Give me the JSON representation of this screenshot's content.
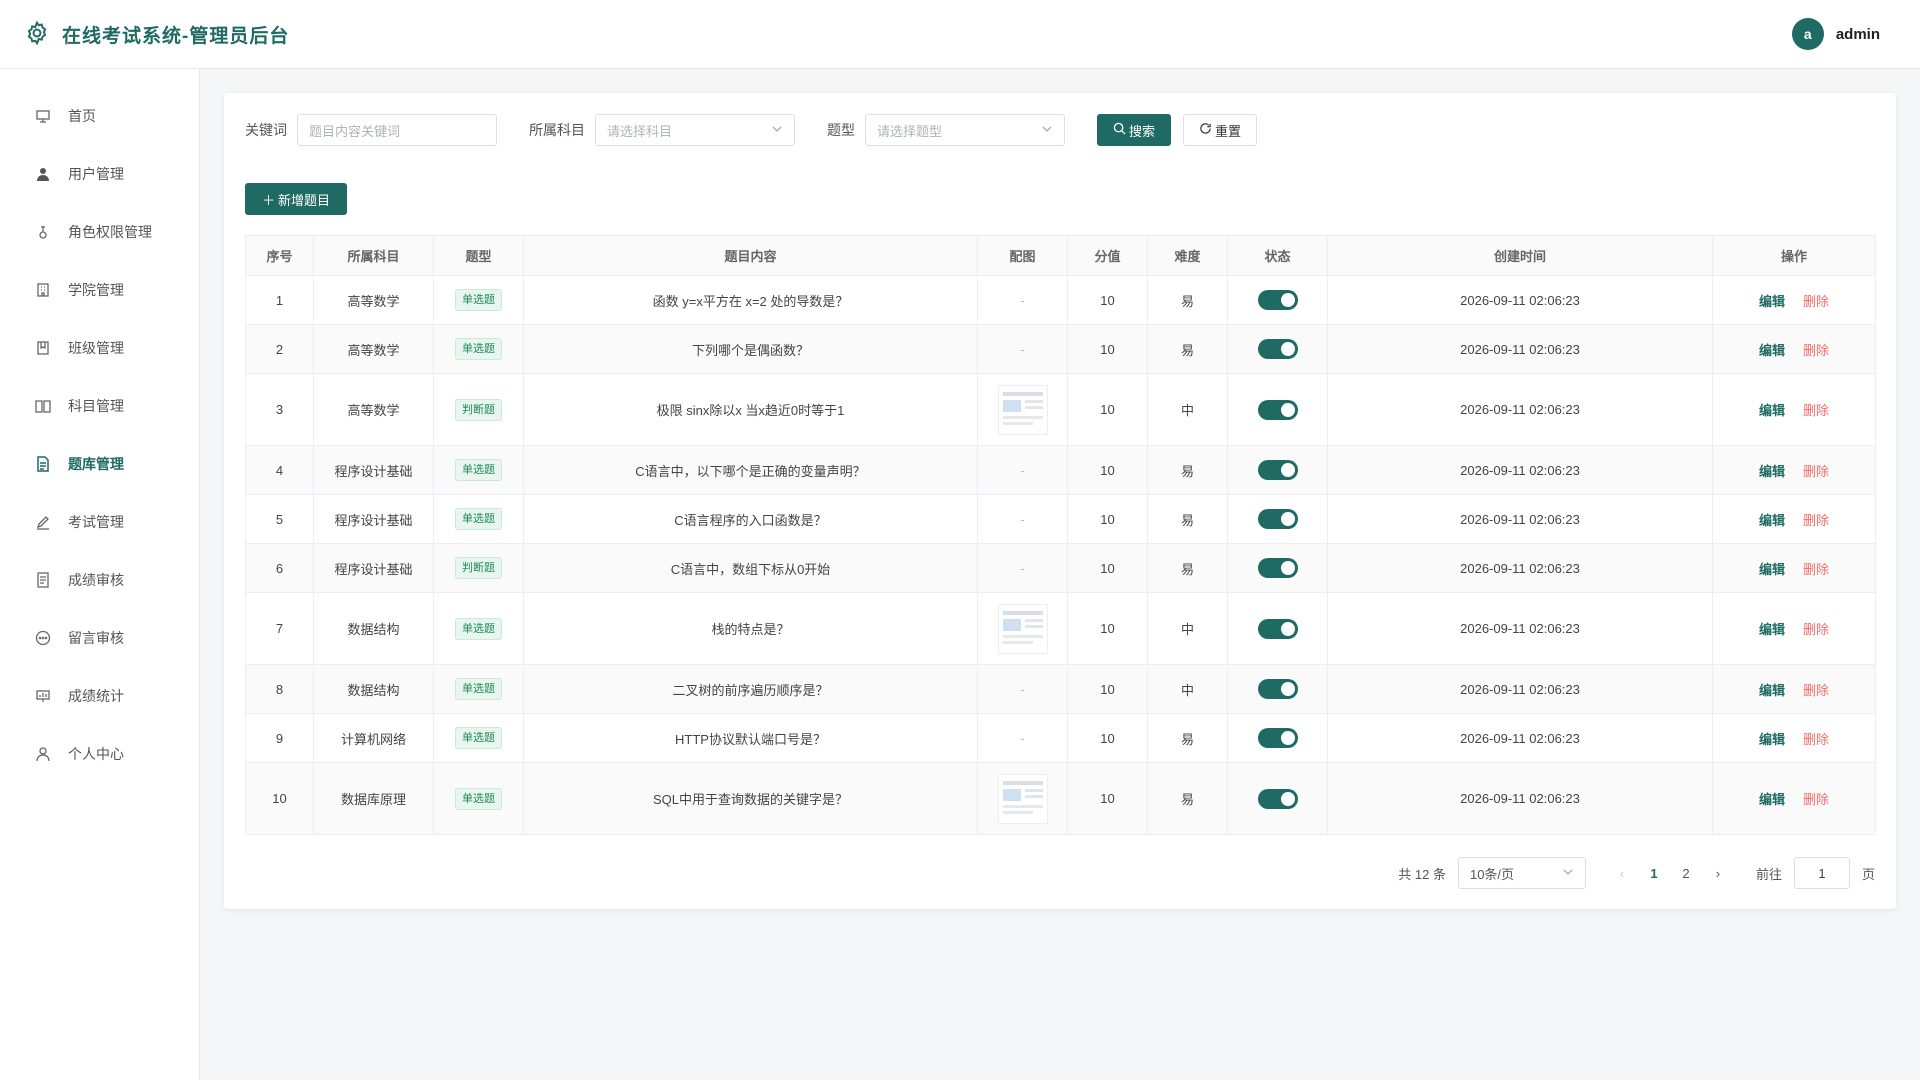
{
  "header": {
    "title": "在线考试系统-管理员后台",
    "avatar_letter": "a",
    "username": "admin"
  },
  "sidebar": {
    "items": [
      {
        "label": "首页",
        "icon": "home-icon"
      },
      {
        "label": "用户管理",
        "icon": "user-icon"
      },
      {
        "label": "角色权限管理",
        "icon": "role-icon"
      },
      {
        "label": "学院管理",
        "icon": "building-icon"
      },
      {
        "label": "班级管理",
        "icon": "class-icon"
      },
      {
        "label": "科目管理",
        "icon": "book-icon"
      },
      {
        "label": "题库管理",
        "icon": "question-bank-icon",
        "active": true
      },
      {
        "label": "考试管理",
        "icon": "exam-icon"
      },
      {
        "label": "成绩审核",
        "icon": "score-review-icon"
      },
      {
        "label": "留言审核",
        "icon": "message-icon"
      },
      {
        "label": "成绩统计",
        "icon": "stats-icon"
      },
      {
        "label": "个人中心",
        "icon": "profile-icon"
      }
    ]
  },
  "filters": {
    "keyword_label": "关键词",
    "keyword_placeholder": "题目内容关键词",
    "subject_label": "所属科目",
    "subject_placeholder": "请选择科目",
    "type_label": "题型",
    "type_placeholder": "请选择题型",
    "search_label": "搜索",
    "reset_label": "重置"
  },
  "add_label": "新增题目",
  "table": {
    "columns": [
      "序号",
      "所属科目",
      "题型",
      "题目内容",
      "配图",
      "分值",
      "难度",
      "状态",
      "创建时间",
      "操作"
    ],
    "edit_label": "编辑",
    "delete_label": "删除",
    "rows": [
      {
        "no": "1",
        "subject": "高等数学",
        "type": "单选题",
        "content": "函数 y=x平方在 x=2 处的导数是？",
        "image": "-",
        "score": "10",
        "difficulty": "易",
        "time": "2026-09-11 02:06:23"
      },
      {
        "no": "2",
        "subject": "高等数学",
        "type": "单选题",
        "content": "下列哪个是偶函数？",
        "image": "-",
        "score": "10",
        "difficulty": "易",
        "time": "2026-09-11 02:06:23"
      },
      {
        "no": "3",
        "subject": "高等数学",
        "type": "判断题",
        "content": "极限 sinx除以x 当x趋近0时等于1",
        "image": "",
        "score": "10",
        "difficulty": "中",
        "time": "2026-09-11 02:06:23"
      },
      {
        "no": "4",
        "subject": "程序设计基础",
        "type": "单选题",
        "content": "C语言中，以下哪个是正确的变量声明？",
        "image": "-",
        "score": "10",
        "difficulty": "易",
        "time": "2026-09-11 02:06:23"
      },
      {
        "no": "5",
        "subject": "程序设计基础",
        "type": "单选题",
        "content": "C语言程序的入口函数是？",
        "image": "-",
        "score": "10",
        "difficulty": "易",
        "time": "2026-09-11 02:06:23"
      },
      {
        "no": "6",
        "subject": "程序设计基础",
        "type": "判断题",
        "content": "C语言中，数组下标从0开始",
        "image": "-",
        "score": "10",
        "difficulty": "易",
        "time": "2026-09-11 02:06:23"
      },
      {
        "no": "7",
        "subject": "数据结构",
        "type": "单选题",
        "content": "栈的特点是？",
        "image": "",
        "score": "10",
        "difficulty": "中",
        "time": "2026-09-11 02:06:23"
      },
      {
        "no": "8",
        "subject": "数据结构",
        "type": "单选题",
        "content": "二叉树的前序遍历顺序是？",
        "image": "-",
        "score": "10",
        "difficulty": "中",
        "time": "2026-09-11 02:06:23"
      },
      {
        "no": "9",
        "subject": "计算机网络",
        "type": "单选题",
        "content": "HTTP协议默认端口号是？",
        "image": "-",
        "score": "10",
        "difficulty": "易",
        "time": "2026-09-11 02:06:23"
      },
      {
        "no": "10",
        "subject": "数据库原理",
        "type": "单选题",
        "content": "SQL中用于查询数据的关键字是？",
        "image": "",
        "score": "10",
        "difficulty": "易",
        "time": "2026-09-11 02:06:23"
      }
    ]
  },
  "pagination": {
    "total": "共 12 条",
    "page_size": "10条/页",
    "pages": [
      "1",
      "2"
    ],
    "current": "1",
    "goto_label": "前往",
    "goto_value": "1",
    "page_suffix": "页"
  }
}
